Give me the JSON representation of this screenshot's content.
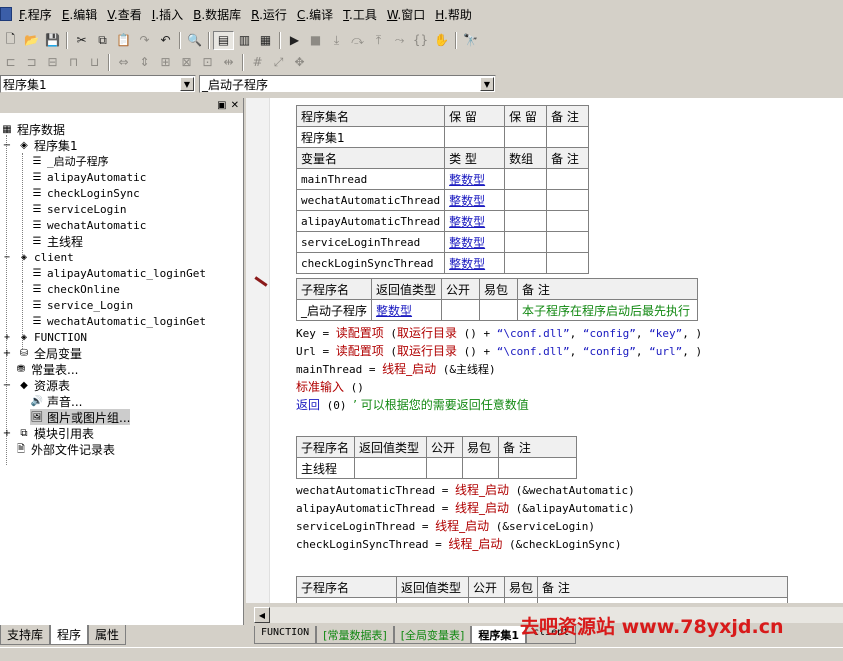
{
  "menubar": {
    "items": [
      {
        "key": "F",
        "label": ".程序"
      },
      {
        "key": "E",
        "label": ".编辑"
      },
      {
        "key": "V",
        "label": ".查看"
      },
      {
        "key": "I",
        "label": ".插入"
      },
      {
        "key": "B",
        "label": ".数据库"
      },
      {
        "key": "R",
        "label": ".运行"
      },
      {
        "key": "C",
        "label": ".编译"
      },
      {
        "key": "T",
        "label": ".工具"
      },
      {
        "key": "W",
        "label": ".窗口"
      },
      {
        "key": "H",
        "label": ".帮助"
      }
    ]
  },
  "combos": {
    "module": "程序集1",
    "sub": "_启动子程序"
  },
  "tree": {
    "root": "程序数据",
    "assembly1": "程序集1",
    "assembly1_items": [
      "_启动子程序",
      "alipayAutomatic",
      "checkLoginSync",
      "serviceLogin",
      "wechatAutomatic",
      "主线程"
    ],
    "client": "client",
    "client_items": [
      "alipayAutomatic_loginGet",
      "checkOnline",
      "service_Login",
      "wechatAutomatic_loginGet"
    ],
    "function": "FUNCTION",
    "globals": "全局变量",
    "constants": "常量表...",
    "resources": "资源表",
    "sound": "声音...",
    "images": "图片或图片组...",
    "module_refs": "模块引用表",
    "external_files": "外部文件记录表"
  },
  "left_tabs": [
    "支持库",
    "程序",
    "属性"
  ],
  "assembly_table": {
    "headers": [
      "程序集名",
      "保 留",
      "保 留",
      "备 注"
    ],
    "name": "程序集1",
    "var_headers": [
      "变量名",
      "类 型",
      "数组",
      "备 注"
    ],
    "vars": [
      {
        "name": "mainThread",
        "type": "整数型"
      },
      {
        "name": "wechatAutomaticThread",
        "type": "整数型"
      },
      {
        "name": "alipayAutomaticThread",
        "type": "整数型"
      },
      {
        "name": "serviceLoginThread",
        "type": "整数型"
      },
      {
        "name": "checkLoginSyncThread",
        "type": "整数型"
      }
    ]
  },
  "sub1": {
    "headers": [
      "子程序名",
      "返回值类型",
      "公开",
      "易包",
      "备 注"
    ],
    "name": "_启动子程序",
    "ret": "整数型",
    "note": "本子程序在程序启动后最先执行"
  },
  "sub1_code": {
    "l1": {
      "a": "Key = ",
      "fn": "读配置项",
      "b": " (",
      "fn2": "取运行目录",
      "c": " () + ",
      "s1": "“\\conf.dll”",
      "d": ", ",
      "s2": "“config”",
      "e": ", ",
      "s3": "“key”",
      "f": ", )"
    },
    "l2": {
      "a": "Url = ",
      "fn": "读配置项",
      "b": " (",
      "fn2": "取运行目录",
      "c": " () + ",
      "s1": "“\\conf.dll”",
      "d": ", ",
      "s2": "“config”",
      "e": ", ",
      "s3": "“url”",
      "f": ", )"
    },
    "l3": {
      "a": "mainThread = ",
      "fn": "线程_启动",
      "b": " (&主线程)"
    },
    "l4": {
      "fn": "标准输入",
      "b": " ()"
    },
    "l5": {
      "fn": "返回",
      "b": " (0)  ",
      "cm": "’ 可以根据您的需要返回任意数值"
    }
  },
  "sub2": {
    "headers": [
      "子程序名",
      "返回值类型",
      "公开",
      "易包",
      "备 注"
    ],
    "name": "主线程"
  },
  "sub2_code": [
    {
      "a": "wechatAutomaticThread = ",
      "fn": "线程_启动",
      "b": " (&wechatAutomatic)"
    },
    {
      "a": "alipayAutomaticThread = ",
      "fn": "线程_启动",
      "b": " (&alipayAutomatic)"
    },
    {
      "a": "serviceLoginThread = ",
      "fn": "线程_启动",
      "b": " (&serviceLogin)"
    },
    {
      "a": "checkLoginSyncThread = ",
      "fn": "线程_启动",
      "b": " (&checkLoginSync)"
    }
  ],
  "sub3": {
    "headers": [
      "子程序名",
      "返回值类型",
      "公开",
      "易包",
      "备 注"
    ]
  },
  "bottom_tabs": [
    "FUNCTION",
    "[常量数据表]",
    "[全局变量表]",
    "程序集1",
    "client"
  ],
  "watermark": "去吧资源站 www.78yxjd.cn",
  "colors": {
    "keyword": "#b00000",
    "type_link": "#1a1ac0",
    "comment": "#118811",
    "watermark": "#d81a1a"
  }
}
